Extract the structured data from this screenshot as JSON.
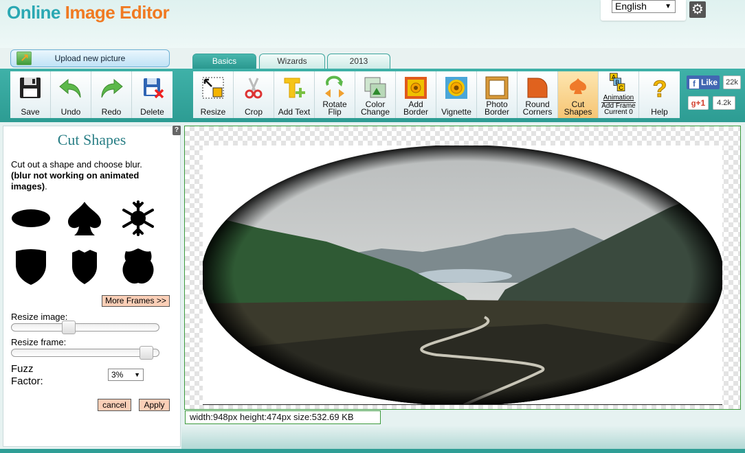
{
  "app": {
    "logo_part1": "Online ",
    "logo_part2": "Image Editor",
    "language": "English"
  },
  "upload": {
    "label": "Upload new picture"
  },
  "tabs": [
    {
      "label": "Basics",
      "active": true
    },
    {
      "label": "Wizards",
      "active": false
    },
    {
      "label": "2013",
      "active": false
    }
  ],
  "toolbar": {
    "left": [
      {
        "label": "Save",
        "icon": "floppy-disk-icon"
      },
      {
        "label": "Undo",
        "icon": "undo-arrow-icon"
      },
      {
        "label": "Redo",
        "icon": "redo-arrow-icon"
      },
      {
        "label": "Delete",
        "icon": "delete-icon"
      }
    ],
    "tools": [
      {
        "label": "Resize",
        "icon": "resize-icon"
      },
      {
        "label": "Crop",
        "icon": "scissors-icon"
      },
      {
        "label": "Add Text",
        "icon": "text-icon"
      },
      {
        "label": "Rotate\nFlip",
        "icon": "rotate-icon"
      },
      {
        "label": "Color\nChange",
        "icon": "color-change-icon"
      },
      {
        "label": "Add\nBorder",
        "icon": "border-icon"
      },
      {
        "label": "Vignette",
        "icon": "vignette-icon"
      },
      {
        "label": "Photo\nBorder",
        "icon": "photo-border-icon"
      },
      {
        "label": "Round\nCorners",
        "icon": "round-corners-icon"
      },
      {
        "label": "Cut\nShapes",
        "icon": "cut-shapes-icon",
        "active": true
      },
      {
        "label": "Animation",
        "icon": "animation-icon",
        "sub1": "Add Frame",
        "sub2": "Current 0"
      },
      {
        "label": "Help",
        "icon": "help-icon"
      }
    ]
  },
  "social": {
    "fb_label": "Like",
    "fb_count": "22k",
    "gplus_label": "+1",
    "gplus_count": "4.2k"
  },
  "panel": {
    "title": "Cut Shapes",
    "description": "Cut out a shape and choose blur.",
    "note": "(blur not working on animated images)",
    "note_suffix": ".",
    "shapes": [
      "ellipse-shape-icon",
      "spade-shape-icon",
      "snowflake-shape-icon",
      "shield-shape-icon",
      "badge-shape-icon",
      "highway-shield-shape-icon"
    ],
    "more_frames": "More Frames >>",
    "resize_image_label": "Resize image:",
    "resize_image_value": 0.37,
    "resize_frame_label": "Resize frame:",
    "resize_frame_value": 0.95,
    "fuzz_label": "Fuzz\nFactor:",
    "fuzz_value": "3%",
    "cancel": "cancel",
    "apply": "Apply"
  },
  "status": {
    "info": "width:948px  height:474px  size:532.69 KB"
  }
}
